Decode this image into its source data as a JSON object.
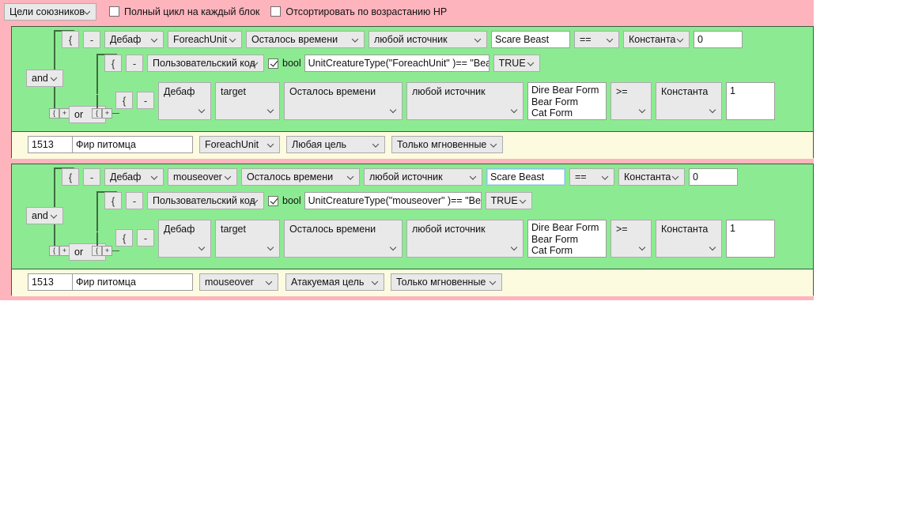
{
  "header": {
    "target_select": {
      "value": "Цели союзников"
    },
    "checkbox_full_cycle": {
      "label": "Полный цикл на каждый блок",
      "checked": false
    },
    "checkbox_sort_hp": {
      "label": "Отсортировать по возрастанию HP",
      "checked": false
    }
  },
  "symbols": {
    "brace": "{",
    "minus": "-",
    "plus": "+",
    "tiny_brace": "{",
    "bool_label": "bool"
  },
  "colors": {
    "header_pink": "#feb4bd",
    "block_green": "#8ceb92",
    "action_cream": "#fcfbdf",
    "block_border": "#3c5a3c",
    "connector": "#3f6b3f",
    "control_face": "#e9e9e9",
    "control_border": "#acacac",
    "focus_border": "#7fc2e8"
  },
  "blocks": [
    {
      "id": "block-1",
      "logic_and": "and",
      "logic_or": "or",
      "conditions": [
        {
          "id": "cond-1-1",
          "kind": "aura",
          "brace": "{",
          "minus": "-",
          "type": "Дебаф",
          "unit": "ForeachUnit",
          "property": "Осталось времени",
          "source": "любой источник",
          "name": "Scare Beast",
          "operator": "==",
          "value_type": "Константа",
          "value": "0"
        },
        {
          "id": "cond-1-2",
          "kind": "code",
          "brace": "{",
          "minus": "-",
          "type": "Пользовательский код",
          "bool_checked": true,
          "bool_label": "bool",
          "code": "UnitCreatureType(\"ForeachUnit\" )== \"Beast\"",
          "expected": "TRUE"
        },
        {
          "id": "cond-1-3",
          "kind": "aura-multi",
          "brace": "{",
          "minus": "-",
          "type": "Дебаф",
          "unit": "target",
          "property": "Осталось времени",
          "source": "любой источник",
          "names": "Dire Bear Form\nBear Form\nCat Form",
          "operator": ">=",
          "value_type": "Константа",
          "value": "1"
        }
      ],
      "action": {
        "id": "1513",
        "spell": "Фир питомца",
        "unit": "ForeachUnit",
        "target": "Любая цель",
        "cast_mode": "Только мгновенные"
      }
    },
    {
      "id": "block-2",
      "logic_and": "and",
      "logic_or": "or",
      "conditions": [
        {
          "id": "cond-2-1",
          "kind": "aura",
          "brace": "{",
          "minus": "-",
          "type": "Дебаф",
          "unit": "mouseover",
          "property": "Осталось времени",
          "source": "любой источник",
          "name": "Scare Beast",
          "name_focused": true,
          "operator": "==",
          "value_type": "Константа",
          "value": "0"
        },
        {
          "id": "cond-2-2",
          "kind": "code",
          "brace": "{",
          "minus": "-",
          "type": "Пользовательский код",
          "bool_checked": true,
          "bool_label": "bool",
          "code": "UnitCreatureType(\"mouseover\" )== \"Beast\"",
          "expected": "TRUE"
        },
        {
          "id": "cond-2-3",
          "kind": "aura-multi",
          "brace": "{",
          "minus": "-",
          "type": "Дебаф",
          "unit": "target",
          "property": "Осталось времени",
          "source": "любой источник",
          "names": "Dire Bear Form\nBear Form\nCat Form",
          "operator": ">=",
          "value_type": "Константа",
          "value": "1"
        }
      ],
      "action": {
        "id": "1513",
        "spell": "Фир питомца",
        "unit": "mouseover",
        "target": "Атакуемая цель",
        "cast_mode": "Только мгновенные"
      }
    }
  ]
}
